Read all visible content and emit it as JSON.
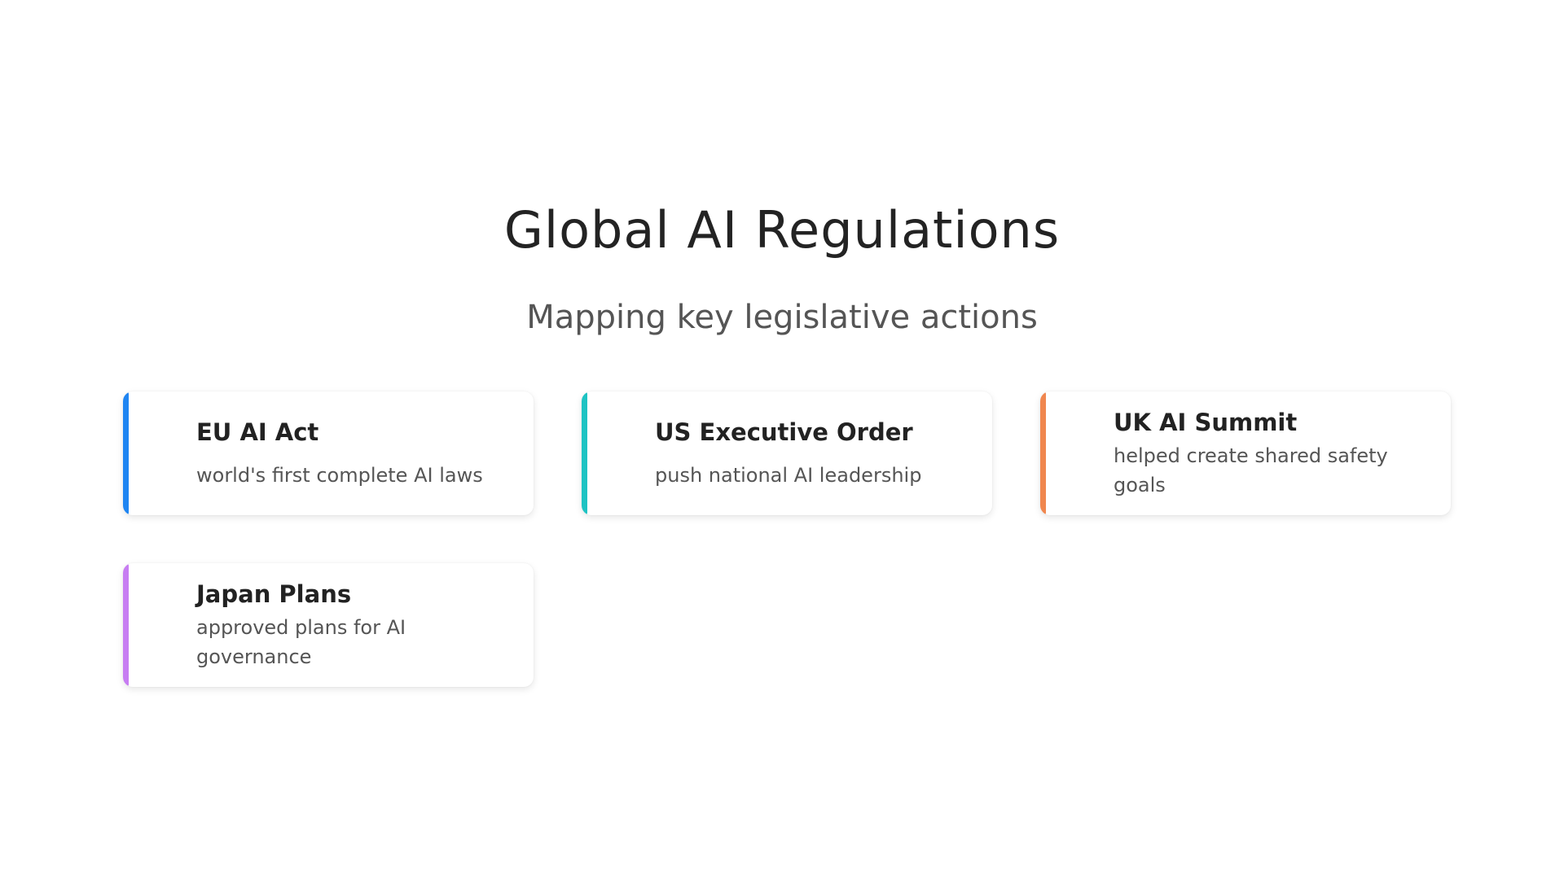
{
  "title": "Global AI Regulations",
  "subtitle": "Mapping key legislative actions",
  "cards": [
    {
      "heading": "EU AI Act",
      "text": "world's first complete AI laws",
      "accent": "#1f85f2"
    },
    {
      "heading": "US Executive Order",
      "text": "push national AI leadership",
      "accent": "#1ec3c3"
    },
    {
      "heading": "UK AI Summit",
      "text": "helped create shared safety goals",
      "accent": "#f0874f"
    },
    {
      "heading": "Japan Plans",
      "text": "approved plans for AI governance",
      "accent": "#c77df2"
    }
  ]
}
